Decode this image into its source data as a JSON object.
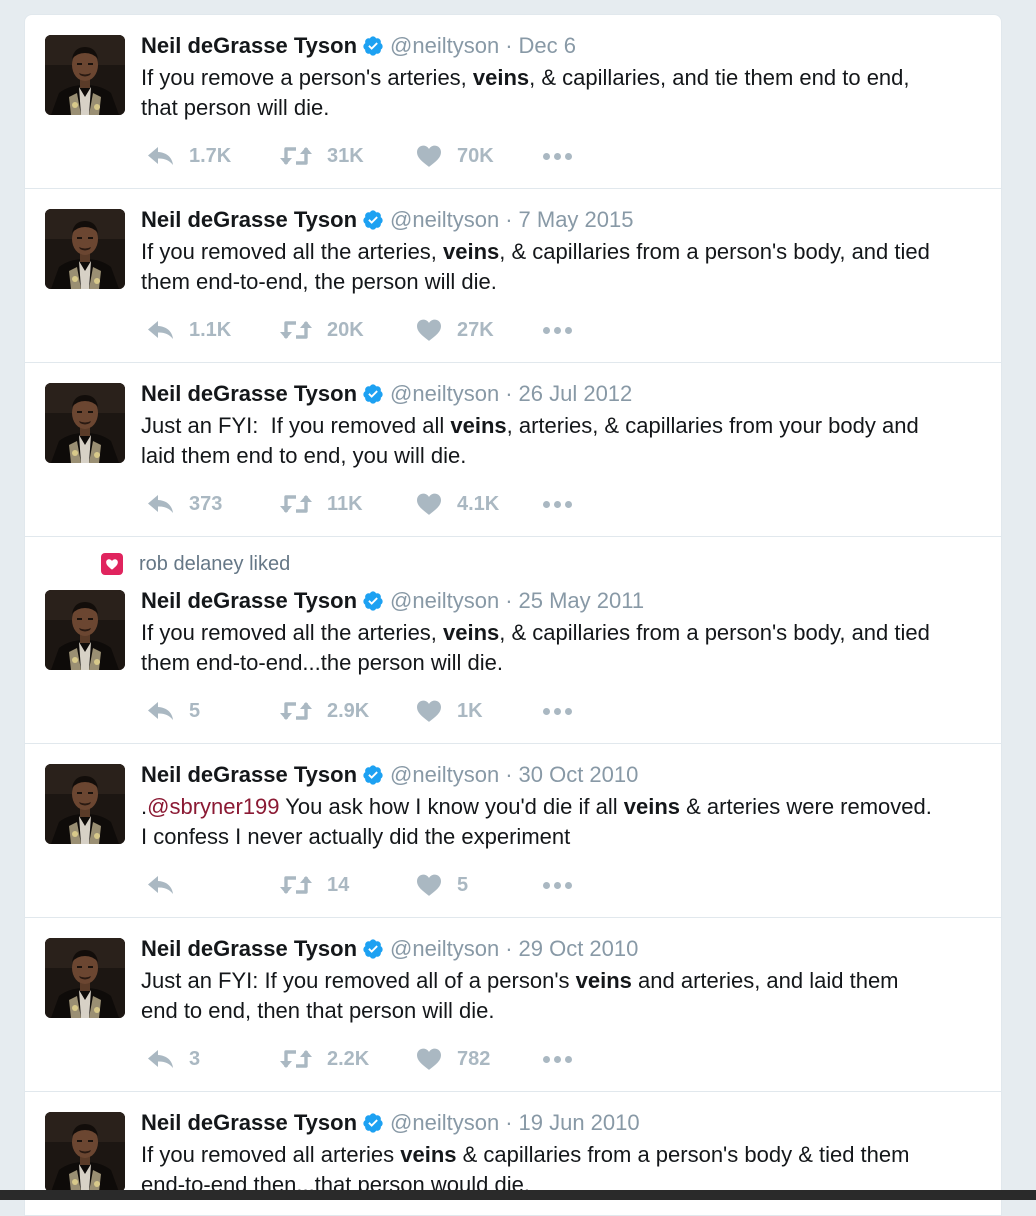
{
  "colors": {
    "verified": "#1da1f2",
    "meta": "#8899a6",
    "action": "#aab8c2",
    "like_badge": "#e0245e",
    "mention": "#8b1a34"
  },
  "tweets": [
    {
      "name": "Neil deGrasse Tyson",
      "handle": "@neiltyson",
      "sep": "·",
      "date": "Dec 6",
      "text": [
        [
          {
            "t": "If you remove a person's arteries, "
          },
          {
            "t": "veins",
            "b": true
          },
          {
            "t": ", & capillaries, and tie them end to end,"
          }
        ],
        [
          {
            "t": "that person will die."
          }
        ]
      ],
      "replies": "1.7K",
      "retweets": "31K",
      "likes": "70K"
    },
    {
      "name": "Neil deGrasse Tyson",
      "handle": "@neiltyson",
      "sep": "·",
      "date": "7 May 2015",
      "text": [
        [
          {
            "t": "If you removed all the arteries, "
          },
          {
            "t": "veins",
            "b": true
          },
          {
            "t": ", & capillaries from a person's body, and tied"
          }
        ],
        [
          {
            "t": "them end-to-end, the person will die."
          }
        ]
      ],
      "replies": "1.1K",
      "retweets": "20K",
      "likes": "27K"
    },
    {
      "name": "Neil deGrasse Tyson",
      "handle": "@neiltyson",
      "sep": "·",
      "date": "26 Jul 2012",
      "text": [
        [
          {
            "t": "Just an FYI:  If you removed all "
          },
          {
            "t": "veins",
            "b": true
          },
          {
            "t": ", arteries, & capillaries from your body and"
          }
        ],
        [
          {
            "t": "laid them end to end, you will die."
          }
        ]
      ],
      "replies": "373",
      "retweets": "11K",
      "likes": "4.1K"
    },
    {
      "context": "rob delaney liked",
      "name": "Neil deGrasse Tyson",
      "handle": "@neiltyson",
      "sep": "·",
      "date": "25 May 2011",
      "text": [
        [
          {
            "t": "If you removed all the arteries, "
          },
          {
            "t": "veins",
            "b": true
          },
          {
            "t": ", & capillaries from a person's body, and tied"
          }
        ],
        [
          {
            "t": "them end-to-end...the person will die."
          }
        ]
      ],
      "replies": "5",
      "retweets": "2.9K",
      "likes": "1K"
    },
    {
      "name": "Neil deGrasse Tyson",
      "handle": "@neiltyson",
      "sep": "·",
      "date": "30 Oct 2010",
      "text": [
        [
          {
            "t": "."
          },
          {
            "t": "@sbryner199",
            "m": true
          },
          {
            "t": " You ask how I know you'd die if all "
          },
          {
            "t": "veins",
            "b": true
          },
          {
            "t": " & arteries were removed."
          }
        ],
        [
          {
            "t": "I confess I never actually did the experiment"
          }
        ]
      ],
      "replies": "",
      "retweets": "14",
      "likes": "5"
    },
    {
      "name": "Neil deGrasse Tyson",
      "handle": "@neiltyson",
      "sep": "·",
      "date": "29 Oct 2010",
      "text": [
        [
          {
            "t": "Just an FYI: If you removed all of a person's "
          },
          {
            "t": "veins",
            "b": true
          },
          {
            "t": " and arteries, and laid them"
          }
        ],
        [
          {
            "t": "end to end, then that person will die."
          }
        ]
      ],
      "replies": "3",
      "retweets": "2.2K",
      "likes": "782"
    },
    {
      "name": "Neil deGrasse Tyson",
      "handle": "@neiltyson",
      "sep": "·",
      "date": "19 Jun 2010",
      "text": [
        [
          {
            "t": "If you removed all arteries "
          },
          {
            "t": "veins",
            "b": true
          },
          {
            "t": " & capillaries from a person's body & tied them"
          }
        ],
        [
          {
            "t": "end-to-end then...that person would die."
          }
        ]
      ],
      "replies": "",
      "retweets": "",
      "likes": ""
    }
  ]
}
